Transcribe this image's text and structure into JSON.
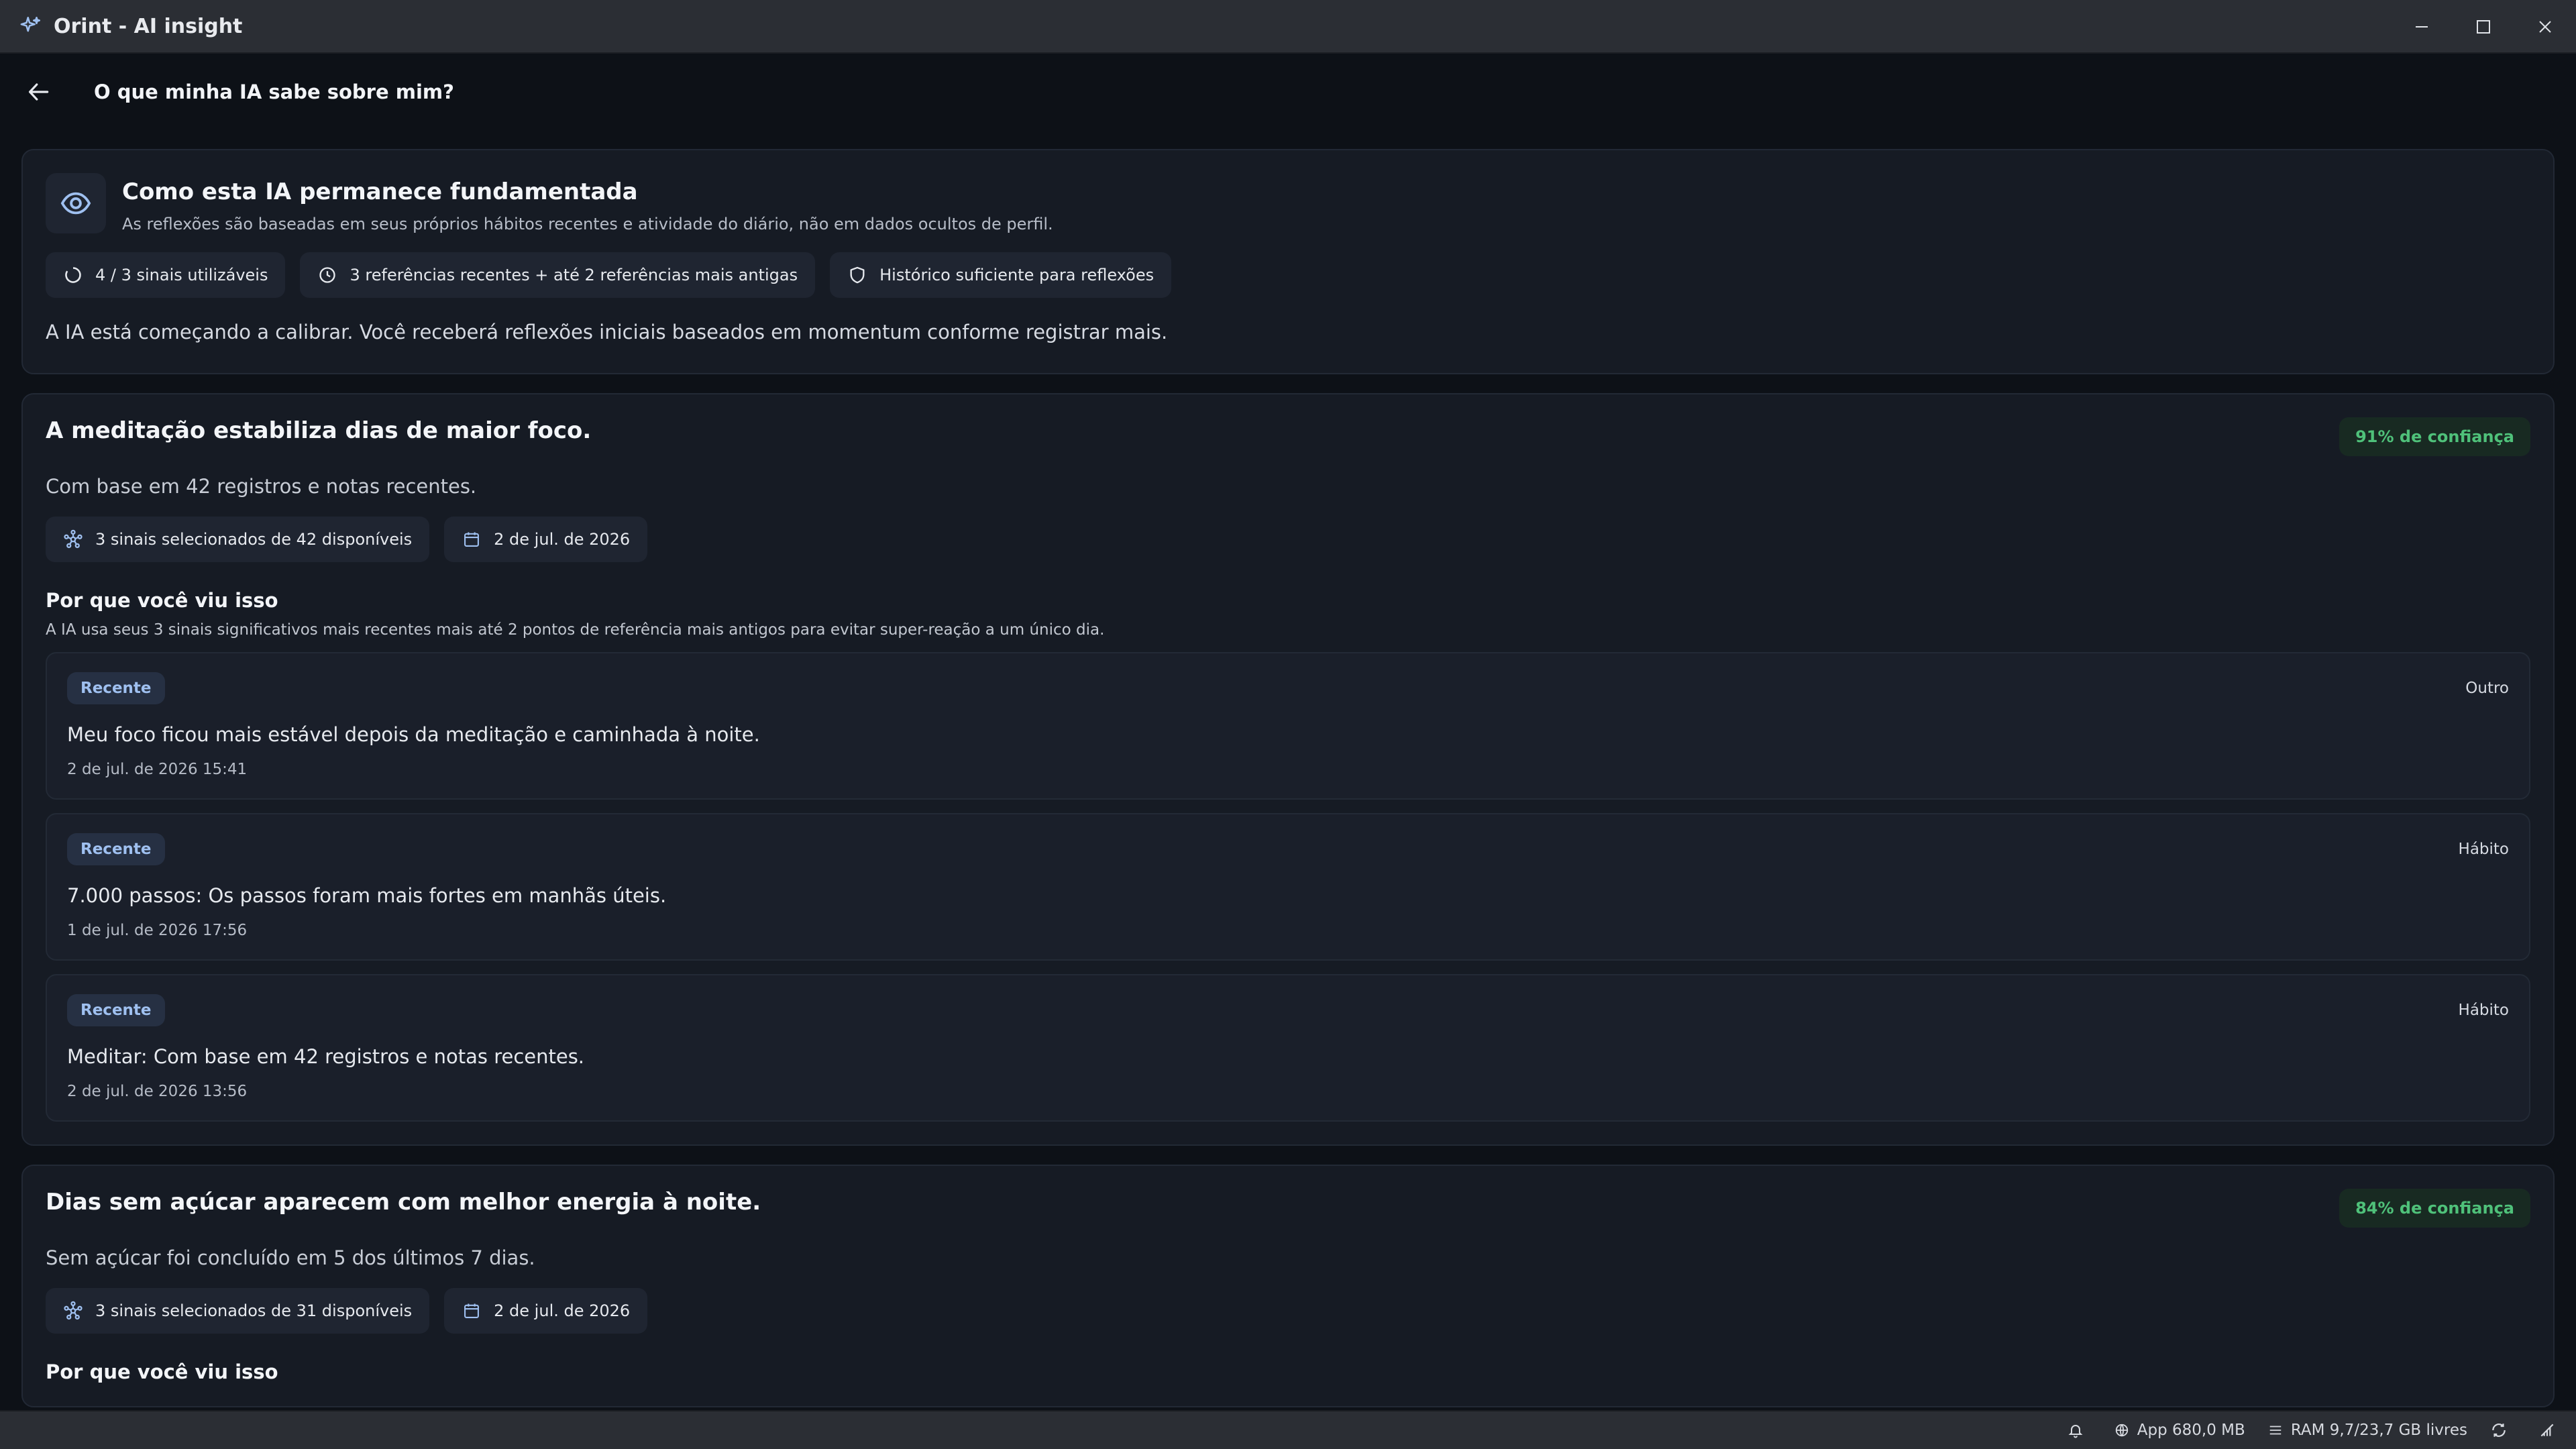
{
  "window": {
    "title": "Orint - AI insight",
    "controls": {
      "minimize": "minimize-icon",
      "maximize": "maximize-icon",
      "close": "close-icon"
    }
  },
  "header": {
    "title": "O que minha IA sabe sobre mim?",
    "back_icon": "arrow-left-icon"
  },
  "intro": {
    "title": "Como esta IA permanece fundamentada",
    "subtitle": "As reflexões são baseadas em seus próprios hábitos recentes e atividade do diário, não em dados ocultos de perfil.",
    "chips": [
      {
        "icon": "circle-progress-icon",
        "label": "4 / 3 sinais utilizáveis"
      },
      {
        "icon": "clock-icon",
        "label": "3 referências recentes + até 2 referências mais antigas"
      },
      {
        "icon": "shield-icon",
        "label": "Histórico suficiente para reflexões"
      }
    ],
    "note": "A IA está começando a calibrar. Você receberá reflexões iniciais baseados em momentum conforme registrar mais."
  },
  "insights": [
    {
      "title": "A meditação estabiliza dias de maior foco.",
      "confidence": "91% de confiança",
      "subtitle": "Com base em 42 registros e notas recentes.",
      "chips": [
        {
          "icon": "signals-icon",
          "label": "3 sinais selecionados de 42 disponíveis"
        },
        {
          "icon": "calendar-icon",
          "label": "2 de jul. de 2026"
        }
      ],
      "why_title": "Por que você viu isso",
      "why_text": "A IA usa seus 3 sinais significativos mais recentes mais até 2 pontos de referência mais antigos para evitar super-reação a um único dia.",
      "refs": [
        {
          "tag": "Recente",
          "type": "Outro",
          "text": "Meu foco ficou mais estável depois da meditação e caminhada à noite.",
          "date": "2 de jul. de 2026 15:41"
        },
        {
          "tag": "Recente",
          "type": "Hábito",
          "text": "7.000 passos: Os passos foram mais fortes em manhãs úteis.",
          "date": "1 de jul. de 2026 17:56"
        },
        {
          "tag": "Recente",
          "type": "Hábito",
          "text": "Meditar: Com base em 42 registros e notas recentes.",
          "date": "2 de jul. de 2026 13:56"
        }
      ]
    },
    {
      "title": "Dias sem açúcar aparecem com melhor energia à noite.",
      "confidence": "84% de confiança",
      "subtitle": "Sem açúcar foi concluído em 5 dos últimos 7 dias.",
      "chips": [
        {
          "icon": "signals-icon",
          "label": "3 sinais selecionados de 31 disponíveis"
        },
        {
          "icon": "calendar-icon",
          "label": "2 de jul. de 2026"
        }
      ],
      "why_title": "Por que você viu isso"
    }
  ],
  "statusbar": {
    "bell_icon": "bell-icon",
    "app_memory": "App 680,0 MB",
    "ram": "RAM 9,7/23,7 GB livres",
    "sync_icon": "sync-icon",
    "network_icon": "network-icon"
  },
  "colors": {
    "background": "#0d1117",
    "card": "#161b24",
    "accent_green": "#4fc17a",
    "tag_blue": "#9fc0f0"
  }
}
